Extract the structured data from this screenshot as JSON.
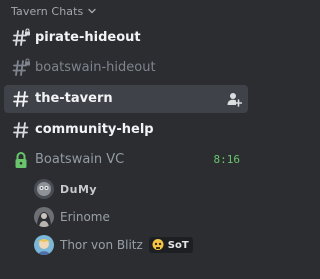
{
  "category": {
    "label": "Tavern Chats",
    "icon": "chevron-down-icon"
  },
  "channels": [
    {
      "name": "pirate-hideout",
      "icon": "hash-lock-icon",
      "state": "unread"
    },
    {
      "name": "boatswain-hideout",
      "icon": "hash-lock-icon",
      "state": "muted"
    },
    {
      "name": "the-tavern",
      "icon": "hash-icon",
      "state": "selected",
      "action_icon": "add-user-icon"
    },
    {
      "name": "community-help",
      "icon": "hash-icon",
      "state": "unread"
    }
  ],
  "voice_channel": {
    "name": "Boatswain VC",
    "icon": "lock-icon",
    "elapsed": "8:16",
    "accent_color": "#6ac46c",
    "members": [
      {
        "name": "DuMy",
        "avatar": "avatar-dumy"
      },
      {
        "name": "Erinome",
        "avatar": "avatar-erinome"
      },
      {
        "name": "Thor von Blitz",
        "avatar": "avatar-thor",
        "badge_text": "SoT",
        "badge_icon": "skull-emoji-icon"
      }
    ]
  },
  "colors": {
    "background": "#2b2d31",
    "selected": "#404249",
    "text": "#f2f3f5",
    "muted": "#80848e"
  }
}
